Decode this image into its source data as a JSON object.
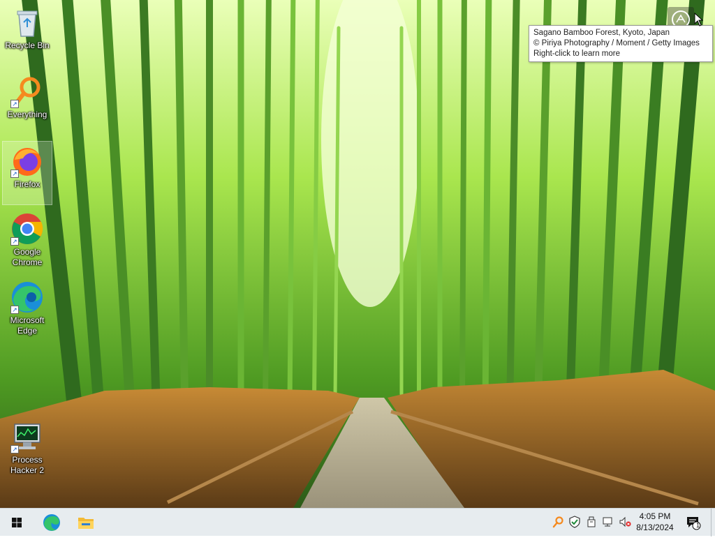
{
  "desktop": {
    "icons": [
      {
        "label": "Recycle Bin",
        "icon": "recycle-bin-icon",
        "shortcut": false,
        "selected": false
      },
      {
        "label": "Everything",
        "icon": "everything-search-icon",
        "shortcut": true,
        "selected": false
      },
      {
        "label": "Firefox",
        "icon": "firefox-icon",
        "shortcut": true,
        "selected": true
      },
      {
        "label": "Google Chrome",
        "icon": "chrome-icon",
        "shortcut": true,
        "selected": false
      },
      {
        "label": "Microsoft Edge",
        "icon": "edge-icon",
        "shortcut": true,
        "selected": false
      },
      {
        "label": "Process Hacker 2",
        "icon": "process-hacker-icon",
        "shortcut": true,
        "selected": false
      }
    ]
  },
  "spotlight": {
    "icon": "camera-lens-icon",
    "tooltip_lines": [
      "Sagano Bamboo Forest, Kyoto, Japan",
      "© Piriya Photography / Moment / Getty Images",
      "Right-click to learn more"
    ]
  },
  "taskbar": {
    "start_icon": "windows-start-icon",
    "pinned": [
      {
        "name": "edge",
        "icon": "edge-icon"
      },
      {
        "name": "file-explorer",
        "icon": "folder-icon"
      }
    ],
    "tray": {
      "icons": [
        "everything-search-icon",
        "shield-icon",
        "usb-drive-icon",
        "network-icon",
        "speaker-muted-icon"
      ],
      "time": "4:05 PM",
      "date": "8/13/2024",
      "notification_count": "1",
      "notification_icon": "action-center-icon"
    }
  },
  "colors": {
    "taskbar_bg": "#e7ecef",
    "accent_blue": "#0078d7",
    "tooltip_bg": "#ffffff"
  }
}
